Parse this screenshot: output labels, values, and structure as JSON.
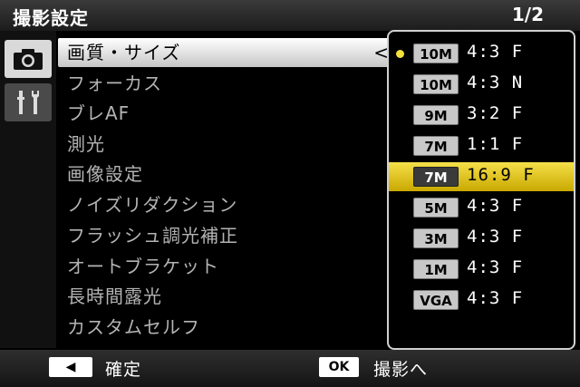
{
  "header": {
    "title": "撮影設定",
    "page": "1/2"
  },
  "tabs": {
    "camera_icon": "camera-icon",
    "settings_icon": "wrench-screwdriver-icon"
  },
  "menu": {
    "items": [
      {
        "label": "画質・サイズ",
        "selected": true
      },
      {
        "label": "フォーカス"
      },
      {
        "label": "ブレAF"
      },
      {
        "label": "測光"
      },
      {
        "label": "画像設定"
      },
      {
        "label": "ノイズリダクション"
      },
      {
        "label": "フラッシュ調光補正"
      },
      {
        "label": "オートブラケット"
      },
      {
        "label": "長時間露光"
      },
      {
        "label": "カスタムセルフ"
      }
    ],
    "selected_arrow": "<"
  },
  "options": [
    {
      "size": "10M",
      "ratio": "4:3 F",
      "current": true
    },
    {
      "size": "10M",
      "ratio": "4:3 N"
    },
    {
      "size": "9M",
      "ratio": "3:2 F"
    },
    {
      "size": "7M",
      "ratio": "1:1 F"
    },
    {
      "size": "7M",
      "ratio": "16:9 F",
      "highlighted": true
    },
    {
      "size": "5M",
      "ratio": "4:3 F"
    },
    {
      "size": "3M",
      "ratio": "4:3 F"
    },
    {
      "size": "1M",
      "ratio": "4:3 F"
    },
    {
      "size": "VGA",
      "ratio": "4:3 F"
    }
  ],
  "footer": {
    "back_key": "◀",
    "confirm_label": "確定",
    "ok_key": "OK",
    "shoot_label": "撮影へ"
  },
  "colors": {
    "highlight": "#f5e04a",
    "panel_border": "#d0d0d0"
  }
}
